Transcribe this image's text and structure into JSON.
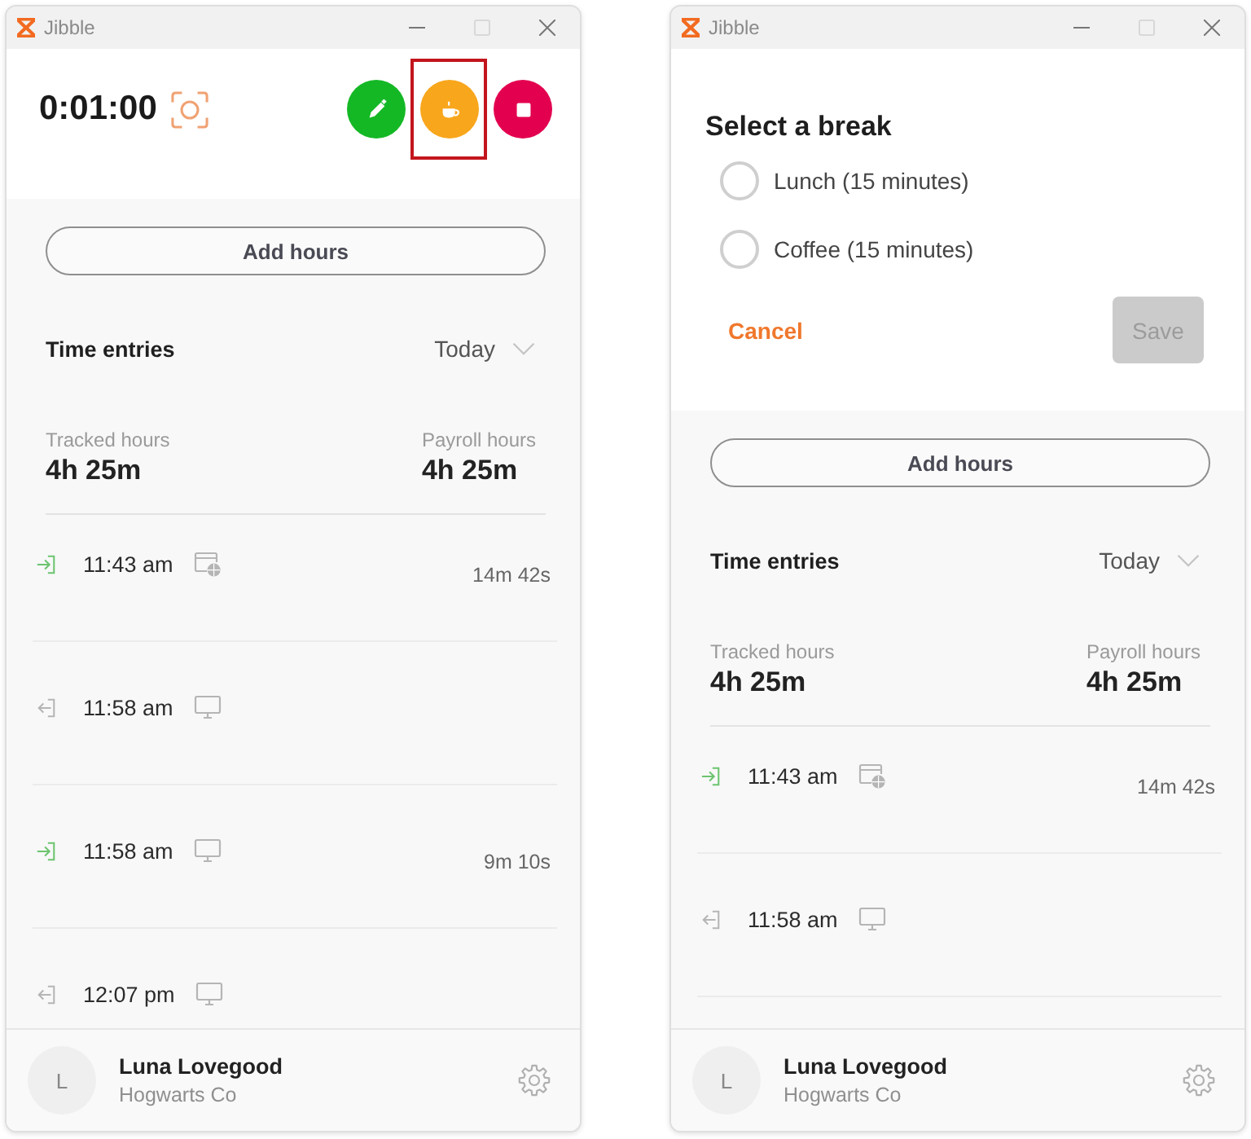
{
  "windows": [
    {
      "title": "Jibble",
      "controls": [
        {
          "kind": "minimize",
          "disabled": false
        },
        {
          "kind": "maximize",
          "disabled": true
        },
        {
          "kind": "close",
          "disabled": false
        }
      ],
      "timer": {
        "time": "0:01:00",
        "actions": [
          {
            "kind": "switch",
            "color": "#14b825",
            "highlighted": false
          },
          {
            "kind": "break",
            "color": "#f8a61c",
            "highlighted": true
          },
          {
            "kind": "stop",
            "color": "#e3004f",
            "highlighted": false
          }
        ]
      },
      "add_hours": "Add hours",
      "time_entries": {
        "title": "Time entries",
        "period": "Today",
        "summary": [
          {
            "label": "Tracked hours",
            "value": "4h 25m"
          },
          {
            "label": "Payroll hours",
            "value": "4h 25m"
          }
        ],
        "entries": [
          {
            "kind": "in",
            "time": "11:43 am",
            "device": {
              "kind": "web"
            },
            "duration": "14m 42s"
          },
          {
            "kind": "out",
            "time": "11:58 am",
            "device": {
              "kind": "desktop"
            }
          },
          {
            "kind": "in",
            "time": "11:58 am",
            "device": {
              "kind": "desktop"
            },
            "duration": "9m 10s"
          },
          {
            "kind": "out",
            "time": "12:07 pm",
            "device": {
              "kind": "desktop"
            }
          }
        ]
      },
      "user": {
        "initial": "L",
        "name": "Luna Lovegood",
        "company": "Hogwarts Co"
      }
    },
    {
      "title": "Jibble",
      "controls": [
        {
          "kind": "minimize",
          "disabled": false
        },
        {
          "kind": "maximize",
          "disabled": true
        },
        {
          "kind": "close",
          "disabled": false
        }
      ],
      "break_dialog": {
        "title": "Select a break",
        "options": [
          {
            "label": "Lunch (15 minutes)",
            "selected": false
          },
          {
            "label": "Coffee (15 minutes)",
            "selected": false
          }
        ],
        "cancel": "Cancel",
        "save": {
          "label": "Save",
          "disabled": true
        }
      },
      "add_hours": "Add hours",
      "time_entries": {
        "title": "Time entries",
        "period": "Today",
        "summary": [
          {
            "label": "Tracked hours",
            "value": "4h 25m"
          },
          {
            "label": "Payroll hours",
            "value": "4h 25m"
          }
        ],
        "entries": [
          {
            "kind": "in",
            "time": "11:43 am",
            "device": {
              "kind": "web"
            },
            "duration": "14m 42s"
          },
          {
            "kind": "out",
            "time": "11:58 am",
            "device": {
              "kind": "desktop"
            }
          }
        ]
      },
      "user": {
        "initial": "L",
        "name": "Luna Lovegood",
        "company": "Hogwarts Co"
      }
    }
  ]
}
